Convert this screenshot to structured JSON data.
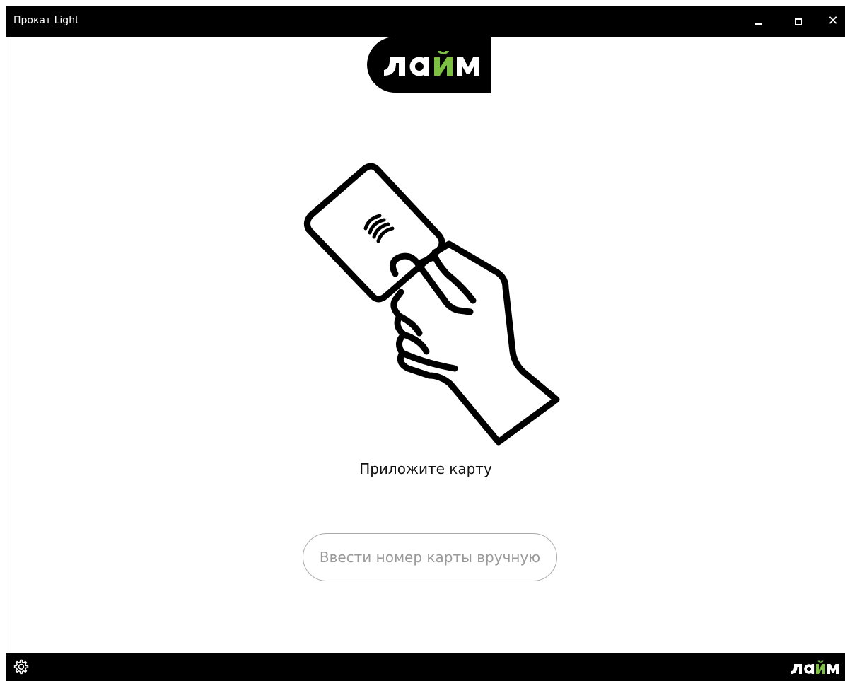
{
  "window": {
    "title": "Прокат Light",
    "minimize_icon": "minimize-icon",
    "maximize_icon": "maximize-icon",
    "close_icon": "close-icon",
    "close_glyph": "✕"
  },
  "brand": {
    "logo_text": "лайм",
    "accent": "#7bc043",
    "dark": "#000000"
  },
  "main": {
    "illustration_icon": "hand-holding-contactless-card-icon",
    "prompt": "Приложите карту",
    "manual_button_label": "Ввести номер карты вручную"
  },
  "footer": {
    "settings_icon": "gear-icon"
  }
}
